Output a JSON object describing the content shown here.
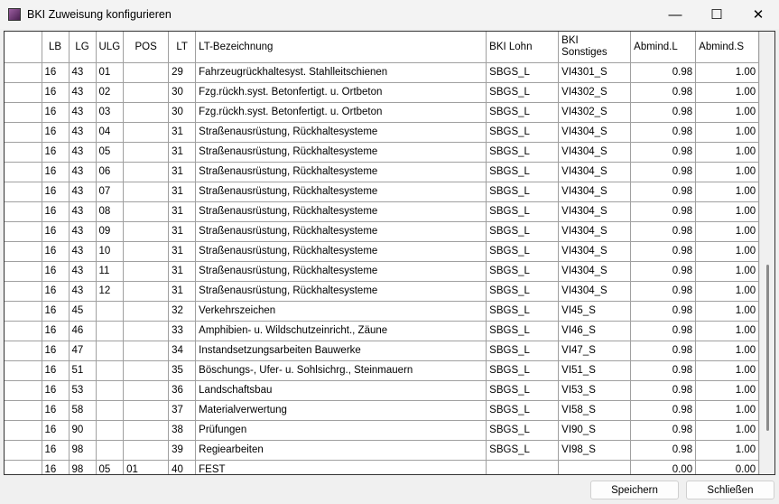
{
  "window": {
    "title": "BKI Zuweisung konfigurieren",
    "minimize": "—",
    "maximize": "☐",
    "close": "✕"
  },
  "columns": [
    "LB",
    "LG",
    "ULG",
    "POS",
    "LT",
    "LT-Bezeichnung",
    "BKI Lohn",
    "BKI Sonstiges",
    "Abmind.L",
    "Abmind.S"
  ],
  "rows": [
    [
      "16",
      "43",
      "01",
      "",
      "29",
      "Fahrzeugrückhaltesyst. Stahlleitschienen",
      "SBGS_L",
      "VI4301_S",
      "0.98",
      "1.00"
    ],
    [
      "16",
      "43",
      "02",
      "",
      "30",
      "Fzg.rückh.syst. Betonfertigt. u. Ortbeton",
      "SBGS_L",
      "VI4302_S",
      "0.98",
      "1.00"
    ],
    [
      "16",
      "43",
      "03",
      "",
      "30",
      "Fzg.rückh.syst. Betonfertigt. u. Ortbeton",
      "SBGS_L",
      "VI4302_S",
      "0.98",
      "1.00"
    ],
    [
      "16",
      "43",
      "04",
      "",
      "31",
      "Straßenausrüstung, Rückhaltesysteme",
      "SBGS_L",
      "VI4304_S",
      "0.98",
      "1.00"
    ],
    [
      "16",
      "43",
      "05",
      "",
      "31",
      "Straßenausrüstung, Rückhaltesysteme",
      "SBGS_L",
      "VI4304_S",
      "0.98",
      "1.00"
    ],
    [
      "16",
      "43",
      "06",
      "",
      "31",
      "Straßenausrüstung, Rückhaltesysteme",
      "SBGS_L",
      "VI4304_S",
      "0.98",
      "1.00"
    ],
    [
      "16",
      "43",
      "07",
      "",
      "31",
      "Straßenausrüstung, Rückhaltesysteme",
      "SBGS_L",
      "VI4304_S",
      "0.98",
      "1.00"
    ],
    [
      "16",
      "43",
      "08",
      "",
      "31",
      "Straßenausrüstung, Rückhaltesysteme",
      "SBGS_L",
      "VI4304_S",
      "0.98",
      "1.00"
    ],
    [
      "16",
      "43",
      "09",
      "",
      "31",
      "Straßenausrüstung, Rückhaltesysteme",
      "SBGS_L",
      "VI4304_S",
      "0.98",
      "1.00"
    ],
    [
      "16",
      "43",
      "10",
      "",
      "31",
      "Straßenausrüstung, Rückhaltesysteme",
      "SBGS_L",
      "VI4304_S",
      "0.98",
      "1.00"
    ],
    [
      "16",
      "43",
      "11",
      "",
      "31",
      "Straßenausrüstung, Rückhaltesysteme",
      "SBGS_L",
      "VI4304_S",
      "0.98",
      "1.00"
    ],
    [
      "16",
      "43",
      "12",
      "",
      "31",
      "Straßenausrüstung, Rückhaltesysteme",
      "SBGS_L",
      "VI4304_S",
      "0.98",
      "1.00"
    ],
    [
      "16",
      "45",
      "",
      "",
      "32",
      "Verkehrszeichen",
      "SBGS_L",
      "VI45_S",
      "0.98",
      "1.00"
    ],
    [
      "16",
      "46",
      "",
      "",
      "33",
      "Amphibien- u. Wildschutzeinricht., Zäune",
      "SBGS_L",
      "VI46_S",
      "0.98",
      "1.00"
    ],
    [
      "16",
      "47",
      "",
      "",
      "34",
      "Instandsetzungsarbeiten Bauwerke",
      "SBGS_L",
      "VI47_S",
      "0.98",
      "1.00"
    ],
    [
      "16",
      "51",
      "",
      "",
      "35",
      "Böschungs-, Ufer- u. Sohlsichrg., Steinmauern",
      "SBGS_L",
      "VI51_S",
      "0.98",
      "1.00"
    ],
    [
      "16",
      "53",
      "",
      "",
      "36",
      "Landschaftsbau",
      "SBGS_L",
      "VI53_S",
      "0.98",
      "1.00"
    ],
    [
      "16",
      "58",
      "",
      "",
      "37",
      "Materialverwertung",
      "SBGS_L",
      "VI58_S",
      "0.98",
      "1.00"
    ],
    [
      "16",
      "90",
      "",
      "",
      "38",
      "Prüfungen",
      "SBGS_L",
      "VI90_S",
      "0.98",
      "1.00"
    ],
    [
      "16",
      "98",
      "",
      "",
      "39",
      "Regiearbeiten",
      "SBGS_L",
      "VI98_S",
      "0.98",
      "1.00"
    ],
    [
      "16",
      "98",
      "05",
      "01",
      "40",
      "FEST",
      "",
      "",
      "0.00",
      "0.00"
    ]
  ],
  "scroll_position_fraction": 0.55,
  "buttons": {
    "save": "Speichern",
    "close": "Schließen"
  }
}
